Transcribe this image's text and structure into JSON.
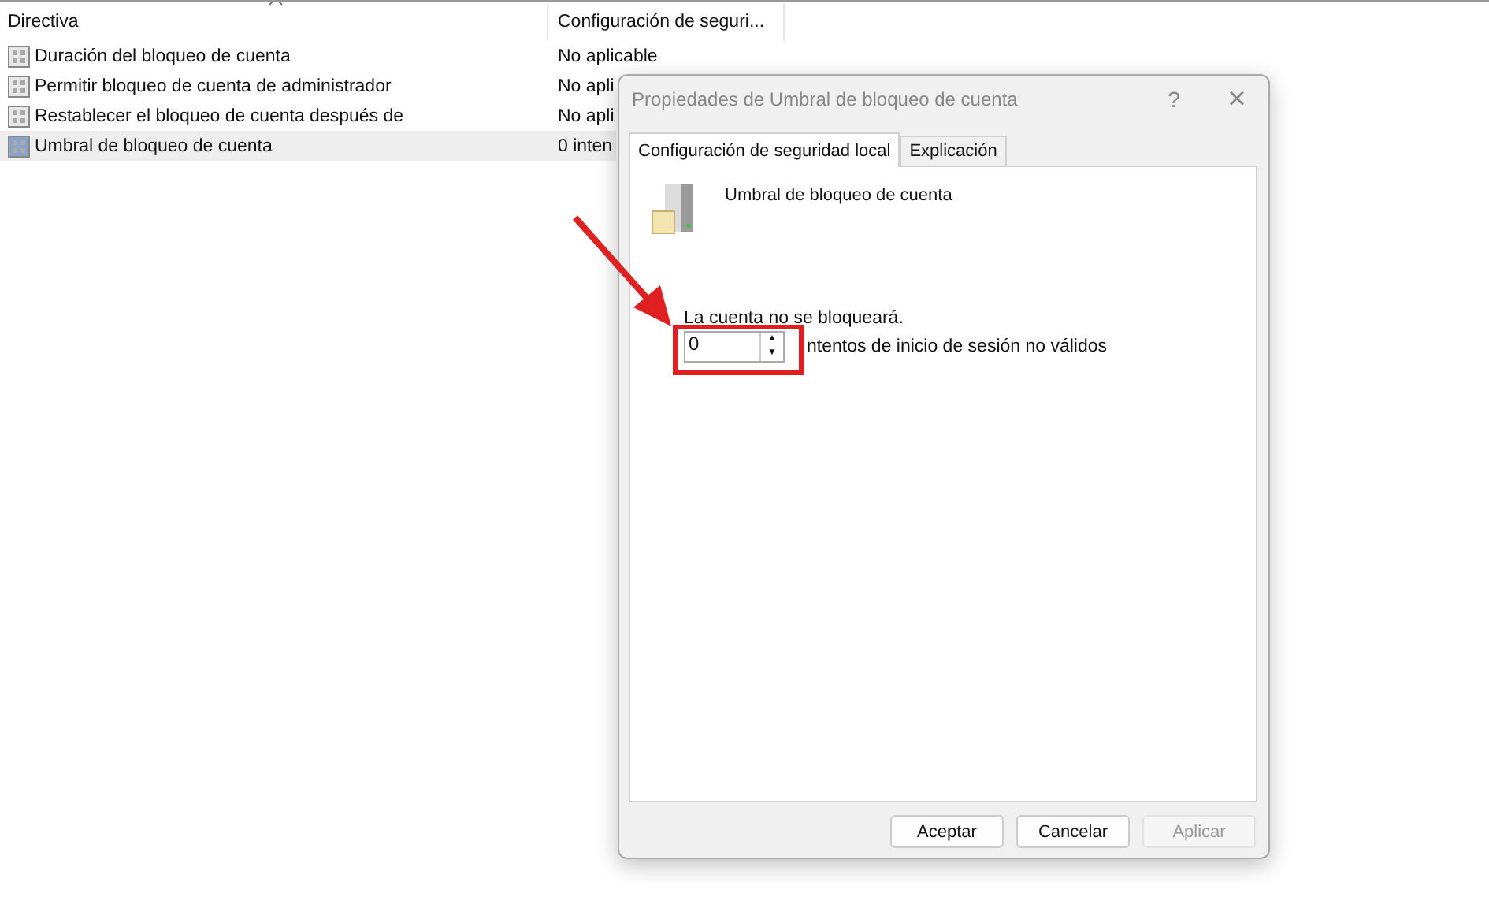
{
  "table": {
    "columns": [
      "Directiva",
      "Configuración de seguri..."
    ],
    "rows": [
      {
        "name": "Duración del bloqueo de cuenta",
        "value": "No aplicable",
        "selected": false
      },
      {
        "name": "Permitir bloqueo de cuenta de administrador",
        "value": "No apli",
        "selected": false
      },
      {
        "name": "Restablecer el bloqueo de cuenta después de",
        "value": "No apli",
        "selected": false
      },
      {
        "name": "Umbral de bloqueo de cuenta",
        "value": "0 inten",
        "selected": true
      }
    ]
  },
  "dialog": {
    "title": "Propiedades de Umbral de bloqueo de cuenta",
    "help": "?",
    "close": "×",
    "tabs": [
      {
        "label": "Configuración de seguridad local",
        "selected": true
      },
      {
        "label": "Explicación",
        "selected": false
      }
    ],
    "policy_name": "Umbral de bloqueo de cuenta",
    "status": "La cuenta no se bloqueará.",
    "spinner": {
      "value": "0",
      "up": "▲",
      "down": "▼",
      "label": "ntentos de inicio de sesión no válidos"
    },
    "buttons": [
      {
        "label": "Aceptar",
        "disabled": false
      },
      {
        "label": "Cancelar",
        "disabled": false
      },
      {
        "label": "Aplicar",
        "disabled": true
      }
    ]
  }
}
